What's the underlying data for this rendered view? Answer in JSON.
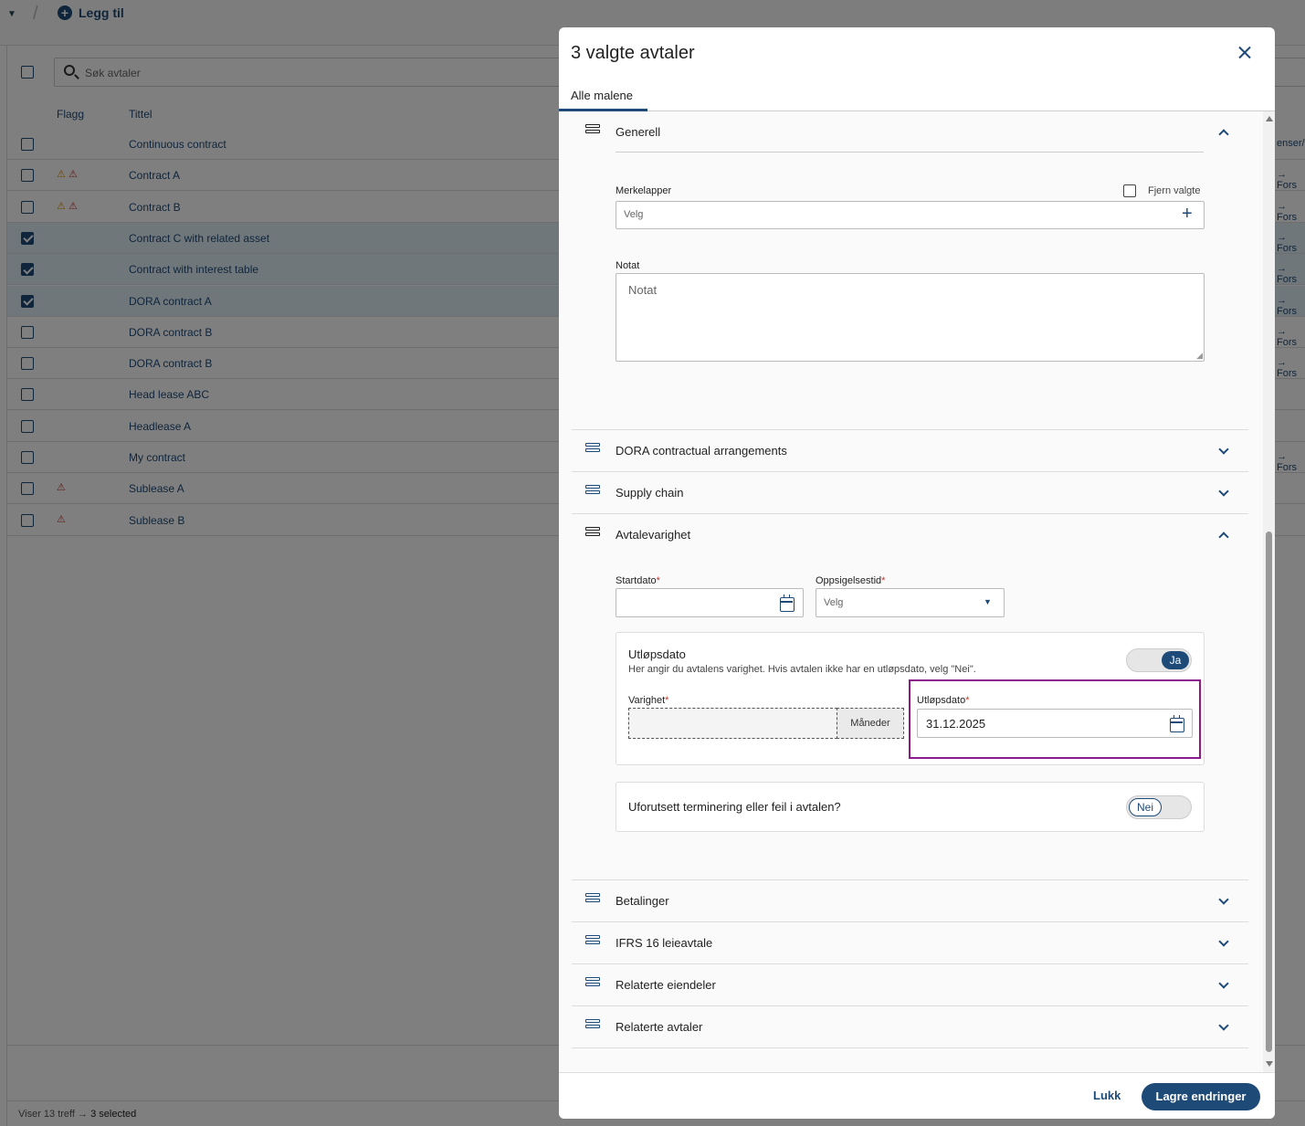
{
  "toolbar": {
    "add_label": "Legg til"
  },
  "list": {
    "search_placeholder": "Søk avtaler",
    "col_flag": "Flagg",
    "col_title": "Tittel",
    "side_header": "enser/",
    "rows": [
      {
        "title": "Continuous contract",
        "checked": false,
        "flags": "",
        "side": ""
      },
      {
        "title": "Contract A",
        "checked": false,
        "flags": "⚠ ⚠",
        "side": "→ Fors"
      },
      {
        "title": "Contract B",
        "checked": false,
        "flags": "⚠ ⚠",
        "side": "→ Fors"
      },
      {
        "title": "Contract C with related asset",
        "checked": true,
        "flags": "",
        "side": "→ Fors"
      },
      {
        "title": "Contract with interest table",
        "checked": true,
        "flags": "",
        "side": "→ Fors"
      },
      {
        "title": "DORA contract A",
        "checked": true,
        "flags": "",
        "side": "→ Fors"
      },
      {
        "title": "DORA contract B",
        "checked": false,
        "flags": "",
        "side": "→ Fors"
      },
      {
        "title": "DORA contract B",
        "checked": false,
        "flags": "",
        "side": "→ Fors"
      },
      {
        "title": "Head lease ABC",
        "checked": false,
        "flags": "",
        "side": ""
      },
      {
        "title": "Headlease A",
        "checked": false,
        "flags": "",
        "side": ""
      },
      {
        "title": "My contract",
        "checked": false,
        "flags": "",
        "side": "→ Fors"
      },
      {
        "title": "Sublease A",
        "checked": false,
        "flags": "⚠",
        "side": ""
      },
      {
        "title": "Sublease B",
        "checked": false,
        "flags": "⚠",
        "side": ""
      }
    ],
    "status_count": "Viser 13 treff",
    "status_arrow": "→",
    "status_selected": "3 selected"
  },
  "modal": {
    "title": "3 valgte avtaler",
    "tab": "Alle malene",
    "generell": {
      "label": "Generell",
      "tags_label": "Merkelapper",
      "remove_selected": "Fjern valgte",
      "tags_placeholder": "Velg",
      "note_label": "Notat",
      "note_placeholder": "Notat"
    },
    "sections_collapsed_1": [
      "DORA contractual arrangements",
      "Supply chain"
    ],
    "avtalevarighet": {
      "label": "Avtalevarighet",
      "start_label": "Startdato",
      "notice_label": "Oppsigelsestid",
      "notice_placeholder": "Velg",
      "expiry_card_title": "Utløpsdato",
      "expiry_card_desc": "Her angir du avtalens varighet. Hvis avtalen ikke har en utløpsdato, velg \"Nei\".",
      "expiry_toggle": "Ja",
      "duration_label": "Varighet",
      "duration_unit": "Måneder",
      "expiry_label": "Utløpsdato",
      "expiry_value": "31.12.2025",
      "termination_question": "Uforutsett terminering eller feil i avtalen?",
      "termination_toggle": "Nei"
    },
    "sections_collapsed_2": [
      "Betalinger",
      "IFRS 16 leieavtale",
      "Relaterte eiendeler",
      "Relaterte avtaler"
    ],
    "footer": {
      "close": "Lukk",
      "save": "Lagre endringer"
    }
  },
  "colors": {
    "primary": "#1e4a78",
    "highlight": "#8b1a8b",
    "selected_row": "#dfeef7",
    "warning_orange": "#e08a00",
    "warning_red": "#c0392b"
  }
}
